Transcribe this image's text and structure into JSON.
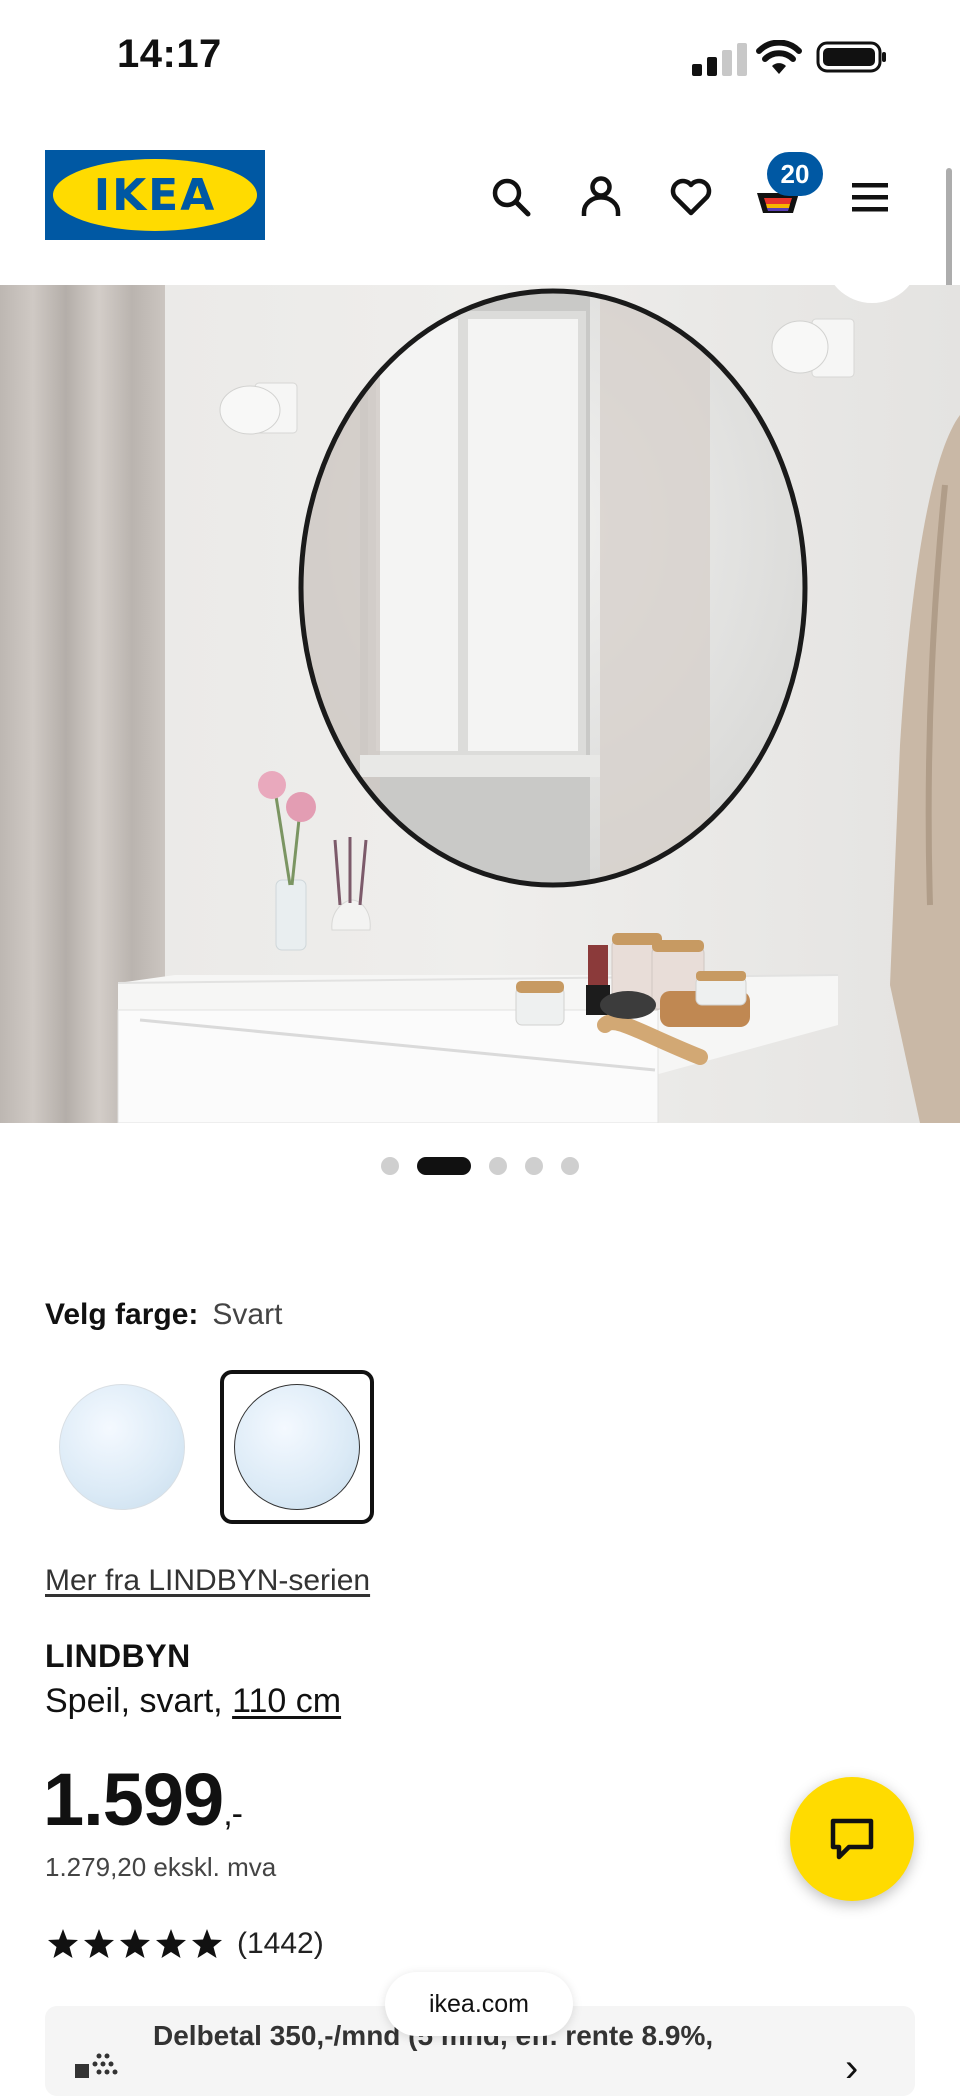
{
  "status_bar": {
    "time": "14:17"
  },
  "header": {
    "logo_text": "IKEA",
    "cart_count": "20",
    "brand_blue": "#0058a3",
    "brand_yellow": "#ffdb00"
  },
  "gallery": {
    "image_count": 5,
    "active_index": 1
  },
  "product": {
    "color_label": "Velg farge:",
    "color_value": "Svart",
    "series_link": "Mer fra LINDBYN-serien",
    "name": "LINDBYN",
    "desc_prefix": "Speil, svart, ",
    "size": "110 cm",
    "price_main": "1.599",
    "price_suffix": ",-",
    "price_ex_vat": "1.279,20 ekskl. mva",
    "rating_stars": 5,
    "review_count": "(1442)"
  },
  "finance": {
    "text": "Delbetal 350,-/mnd (5 mnd, eff. rente 8.9%,"
  },
  "browser": {
    "url": "ikea.com"
  },
  "icons": [
    "search-icon",
    "account-icon",
    "heart-icon",
    "cart-icon",
    "menu-icon",
    "chat-icon",
    "star-icon",
    "chevron-right-icon"
  ]
}
